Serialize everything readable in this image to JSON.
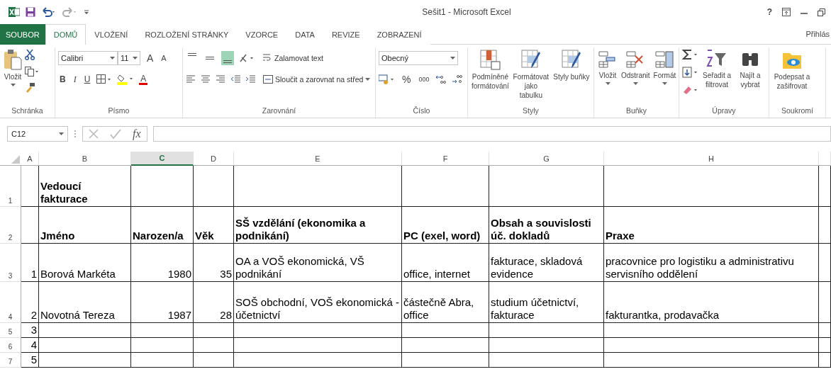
{
  "window": {
    "title": "Sešit1 - Microsoft Excel",
    "help": "?"
  },
  "tabs": [
    {
      "label": "SOUBOR",
      "kind": "file",
      "selected": false
    },
    {
      "label": "DOMŮ",
      "kind": "tab",
      "selected": true
    },
    {
      "label": "VLOŽENÍ",
      "kind": "tab",
      "selected": false
    },
    {
      "label": "ROZLOŽENÍ STRÁNKY",
      "kind": "tab",
      "selected": false
    },
    {
      "label": "VZORCE",
      "kind": "tab",
      "selected": false
    },
    {
      "label": "DATA",
      "kind": "tab",
      "selected": false
    },
    {
      "label": "REVIZE",
      "kind": "tab",
      "selected": false
    },
    {
      "label": "ZOBRAZENÍ",
      "kind": "tab",
      "selected": false
    }
  ],
  "account": "Přihlás",
  "ribbon": {
    "clipboard": {
      "label": "Schránka",
      "paste": "Vložit"
    },
    "font": {
      "label": "Písmo",
      "family": "Calibri",
      "size": "11",
      "grow_glyph": "A",
      "shrink_glyph": "A",
      "bold_glyph": "B",
      "italic_glyph": "I",
      "underline_glyph": "U",
      "font_color_glyph": "A"
    },
    "alignment": {
      "label": "Zarovnání",
      "vertical": [
        {
          "selected": false
        },
        {
          "selected": false
        },
        {
          "selected": true
        }
      ],
      "wrap": "Zalamovat text",
      "merge": "Sloučit a zarovnat na střed"
    },
    "number": {
      "label": "Číslo",
      "format": "Obecný",
      "percent": "%",
      "thousands": "000"
    },
    "styles": {
      "label": "Styly",
      "buttons": [
        "Podmíněné formátování",
        "Formátovat jako tabulku",
        "Styly buňky"
      ]
    },
    "cells": {
      "label": "Buňky",
      "buttons": [
        "Vložit",
        "Odstranit",
        "Formát"
      ]
    },
    "editing": {
      "label": "Úpravy",
      "buttons": [
        "Seřadit a filtrovat",
        "Najít a vybrat"
      ]
    },
    "privacy": {
      "label": "Soukromí",
      "buttons": [
        "Podepsat a zašifrovat"
      ]
    }
  },
  "formula_bar": {
    "name_box": "C12",
    "function_label": "fx"
  },
  "sheet": {
    "columns": [
      {
        "label": "A",
        "selected": false
      },
      {
        "label": "B",
        "selected": false
      },
      {
        "label": "C",
        "selected": true
      },
      {
        "label": "D",
        "selected": false
      },
      {
        "label": "E",
        "selected": false
      },
      {
        "label": "F",
        "selected": false
      },
      {
        "label": "G",
        "selected": false
      },
      {
        "label": "H",
        "selected": false
      }
    ],
    "rows": [
      {
        "header": "1",
        "cells": {
          "b": {
            "text": "Vedoucí fakturace",
            "kind": "heading"
          }
        }
      },
      {
        "header": "2",
        "cells": {
          "b": {
            "text": "Jméno",
            "kind": "heading"
          },
          "c": {
            "text": "Narozen/a",
            "kind": "heading"
          },
          "d": {
            "text": "Věk",
            "kind": "heading"
          },
          "e": {
            "text": "SŠ vzdělání (ekonomika a podnikání)",
            "kind": "heading"
          },
          "f": {
            "text": "PC (exel, word)",
            "kind": "heading"
          },
          "g": {
            "text": "Obsah a souvislosti úč. dokladů",
            "kind": "heading"
          },
          "h": {
            "text": "Praxe",
            "kind": "heading"
          }
        }
      },
      {
        "header": "3",
        "cells": {
          "a": {
            "text": "1",
            "kind": "number"
          },
          "b": {
            "text": "Borová Markéta",
            "kind": "text"
          },
          "c": {
            "text": "1980",
            "kind": "number"
          },
          "d": {
            "text": "35",
            "kind": "number"
          },
          "e": {
            "text": "OA a VOŠ ekonomická, VŠ podnikání",
            "kind": "text"
          },
          "f": {
            "text": "office, internet",
            "kind": "text"
          },
          "g": {
            "text": "fakturace, skladová evidence",
            "kind": "text"
          },
          "h": {
            "text": "pracovnice pro logistiku a administrativu servisního oddělení",
            "kind": "text"
          }
        }
      },
      {
        "header": "4",
        "cells": {
          "a": {
            "text": "2",
            "kind": "number"
          },
          "b": {
            "text": "Novotná Tereza",
            "kind": "text"
          },
          "c": {
            "text": "1987",
            "kind": "number"
          },
          "d": {
            "text": "28",
            "kind": "number"
          },
          "e": {
            "text": "SOŠ obchodní, VOŠ ekonomická - účetnictví",
            "kind": "text"
          },
          "f": {
            "text": "částečně Abra, office",
            "kind": "text"
          },
          "g": {
            "text": "studium účetnictví, fakturace",
            "kind": "text"
          },
          "h": {
            "text": "fakturantka, prodavačka",
            "kind": "text"
          }
        }
      },
      {
        "header": "5",
        "cells": {
          "a": {
            "text": "3",
            "kind": "number"
          }
        }
      },
      {
        "header": "6",
        "cells": {
          "a": {
            "text": "4",
            "kind": "number"
          }
        }
      },
      {
        "header": "7",
        "cells": {
          "a": {
            "text": "5",
            "kind": "number"
          }
        }
      }
    ]
  }
}
